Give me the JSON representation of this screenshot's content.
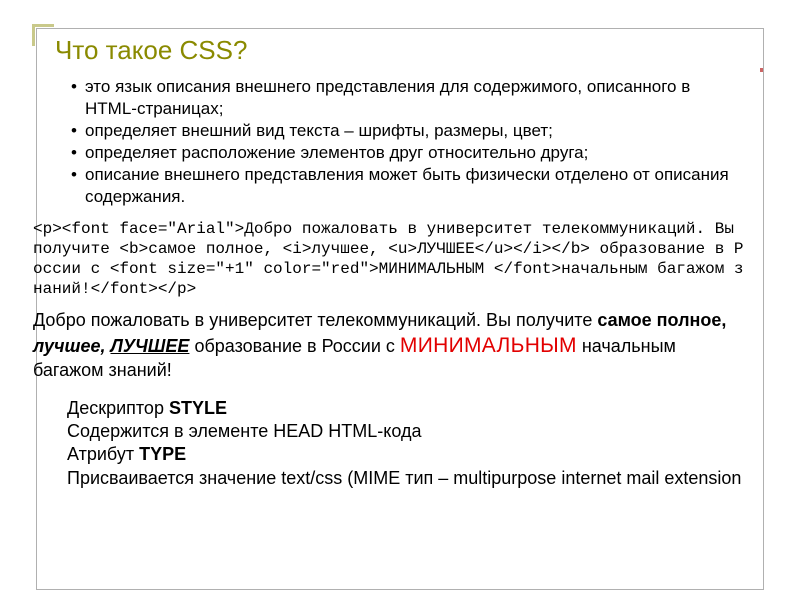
{
  "title": "Что такое CSS?",
  "bullets": [
    "это язык описания внешнего представления для содержимого, описанного в HTML-страницах;",
    "определяет внешний вид текста – шрифты, размеры, цвет;",
    "определяет расположение элементов друг относительно друга;",
    "описание внешнего представления может быть физически отделено от описания содержания."
  ],
  "code": "<p><font face=\"Arial\">Добро пожаловать в университет телекоммуникаций. Вы получите <b>самое полное, <i>лучшее, <u>ЛУЧШЕЕ</u></i></b> образование в России с <font size=\"+1\" color=\"red\">МИНИМАЛЬНЫМ </font>начальным багажом знаний!</font></p>",
  "rendered": {
    "t1": "Добро пожаловать в университет телекоммуникаций. Вы получите ",
    "t2": "самое полное, ",
    "t3": "лучшее, ",
    "t4": "ЛУЧШЕЕ",
    "t5": " образование в России с ",
    "t6": "МИНИМАЛЬНЫМ",
    "t7": " начальным багажом знаний!"
  },
  "descriptor": {
    "line1a": "Дескриптор ",
    "line1b": "STYLE",
    "line2": "Содержится в элементе HEAD HTML-кода",
    "line3a": "Атрибут ",
    "line3b": "TYPE",
    "line4": "Присваивается значение text/css (MIME тип – multipurpose internet mail extension"
  }
}
